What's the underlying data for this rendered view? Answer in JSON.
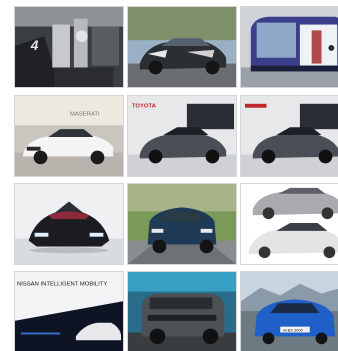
{
  "gallery": {
    "thumbnails": [
      {
        "name": "photo-1",
        "caption": "4"
      },
      {
        "name": "photo-2",
        "caption": ""
      },
      {
        "name": "photo-3",
        "caption": ""
      },
      {
        "name": "photo-4",
        "caption": "MASERATI"
      },
      {
        "name": "photo-5",
        "caption": "TOYOTA"
      },
      {
        "name": "photo-6",
        "caption": ""
      },
      {
        "name": "photo-7",
        "caption": ""
      },
      {
        "name": "photo-8",
        "caption": ""
      },
      {
        "name": "photo-9",
        "caption": ""
      },
      {
        "name": "photo-10",
        "caption": "NISSAN INTELLIGENT MOBILITY"
      },
      {
        "name": "photo-11",
        "caption": ""
      },
      {
        "name": "photo-12",
        "caption": "M·BX 2000"
      }
    ]
  }
}
